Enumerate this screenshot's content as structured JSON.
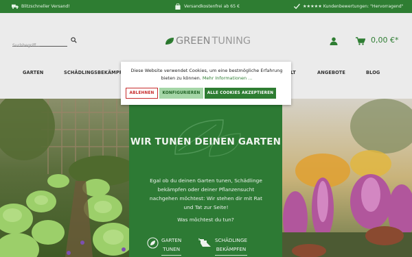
{
  "topbar": {
    "shipping": "Blitzschneller Versand!",
    "free_shipping": "Versandkostenfrei ab 65 €",
    "reviews": "★★★★★ Kundenbewertungen: \"Hervorragend\""
  },
  "header": {
    "search_placeholder": "Suchbegriff...",
    "logo_green": "GREEN",
    "logo_tuning": "TUNING",
    "cart_total": "0,00 €*"
  },
  "nav": {
    "items": [
      "GARTEN",
      "SCHÄDLINGSBEKÄMPF",
      "LT",
      "ANGEBOTE",
      "BLOG"
    ]
  },
  "cookie": {
    "text": "Diese Website verwendet Cookies, um eine bestmögliche Erfahrung bieten zu können.",
    "more_link": "Mehr Informationen ...",
    "decline": "ABLEHNEN",
    "configure": "KONFIGURIEREN",
    "accept_all": "ALLE COOKIES AKZEPTIEREN"
  },
  "hero": {
    "title": "WIR TUNEN DEINEN GARTEN",
    "lead": "Egal ob du deinen Garten tunen, Schädlinge bekämpfen oder deiner Pflanzensucht nachgehen möchtest: Wir stehen dir mit Rat und Tat zur Seite!",
    "question": "Was möchtest du tun?",
    "cat1_line1": "GARTEN",
    "cat1_line2": "TUNEN",
    "cat2_line1": "SCHÄDLINGE",
    "cat2_line2": "BEKÄMPFEN"
  },
  "colors": {
    "brand_green": "#2e7d32",
    "panel_green": "#2d7a34",
    "decline_red": "#c62828"
  }
}
